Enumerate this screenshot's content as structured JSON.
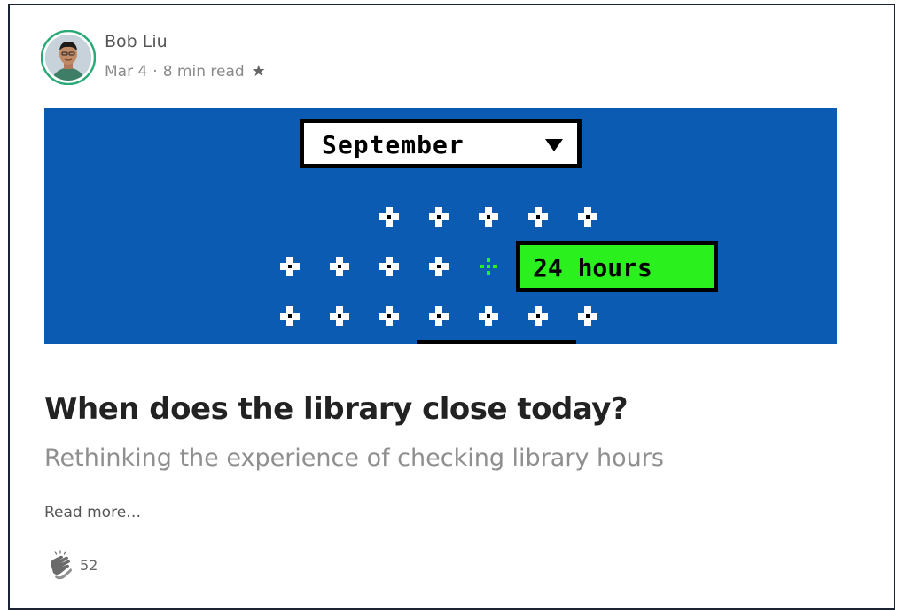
{
  "author": {
    "name": "Bob Liu",
    "date": "Mar 4",
    "read_time": "8 min read",
    "avatar_icon": "avatar-photo",
    "star_icon": "star-icon"
  },
  "hero": {
    "month": "September",
    "hours": "24 hours",
    "background_color": "#0b5bb3",
    "hours_color": "#2af01e",
    "selected_day_color": "#2af01e"
  },
  "article": {
    "title": "When does the library close today?",
    "subtitle": "Rethinking the experience of checking library hours",
    "read_more": "Read more…"
  },
  "claps": {
    "count": "52",
    "icon": "clap-icon"
  }
}
